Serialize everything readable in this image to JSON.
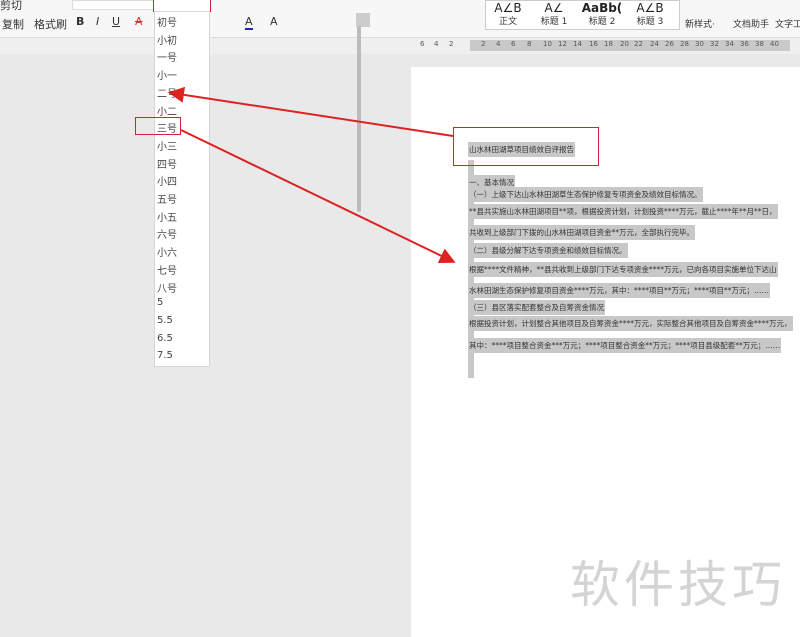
{
  "ribbon": {
    "cut": "剪切",
    "copy": "复制",
    "format_painter": "格式刷",
    "bold": "B",
    "italic": "I",
    "underline": "U",
    "strike": "A",
    "font_color": "A",
    "char_shade": "A",
    "styles": [
      {
        "preview": "A∠B",
        "label": "正文"
      },
      {
        "preview": "A∠",
        "label": "标题 1"
      },
      {
        "preview": "AaBb(",
        "label": "标题 2"
      },
      {
        "preview": "A∠B",
        "label": "标题 3"
      }
    ],
    "new_style": "新样式·",
    "doc_helper": "文档助手",
    "text_tools": "文字工"
  },
  "ruler": {
    "ticks": [
      "6",
      "4",
      "2",
      "2",
      "4",
      "6",
      "8",
      "10",
      "12",
      "14",
      "16",
      "18",
      "20",
      "22",
      "24",
      "26",
      "28",
      "30",
      "32",
      "34",
      "36",
      "38",
      "40"
    ]
  },
  "font_size_dropdown": {
    "value": "",
    "options": [
      "初号",
      "小初",
      "一号",
      "小一",
      "二号",
      "小二",
      "三号",
      "小三",
      "四号",
      "小四",
      "五号",
      "小五",
      "六号",
      "小六",
      "七号",
      "八号",
      "5",
      "5.5",
      "6.5",
      "7.5"
    ],
    "highlighted": "三号"
  },
  "document": {
    "title": "山水林田湖草项目绩效自评报告",
    "lines": [
      "一、基本情况",
      "（一）上级下达山水林田湖草生态保护修复专项资金及绩效目标情况。",
      "**县共实施山水林田湖项目**项，根据投资计划，计划投资****万元，截止****年**月**日，",
      "共收到上级部门下拨的山水林田湖项目资金**万元，全部执行完毕。",
      "（二）县级分解下达专项资金和绩效目标情况。",
      "根据****文件精神，**县共收到上级部门下达专项资金****万元，已向各项目实施单位下达山",
      "水林田湖生态保护修复项目资金****万元，其中：****项目**万元；****项目**万元；……",
      "（三）县区落实配套整合及自筹资金情况",
      "根据投资计划，计划整合其他项目及自筹资金****万元，实际整合其他项目及自筹资金****万元，",
      "其中：****项目整合资金***万元；****项目整合资金**万元；****项目县级配套**万元；……"
    ]
  },
  "watermark": "软件技巧",
  "colors": {
    "annotation": "#c8282e",
    "selection": "#c8c8c8"
  }
}
